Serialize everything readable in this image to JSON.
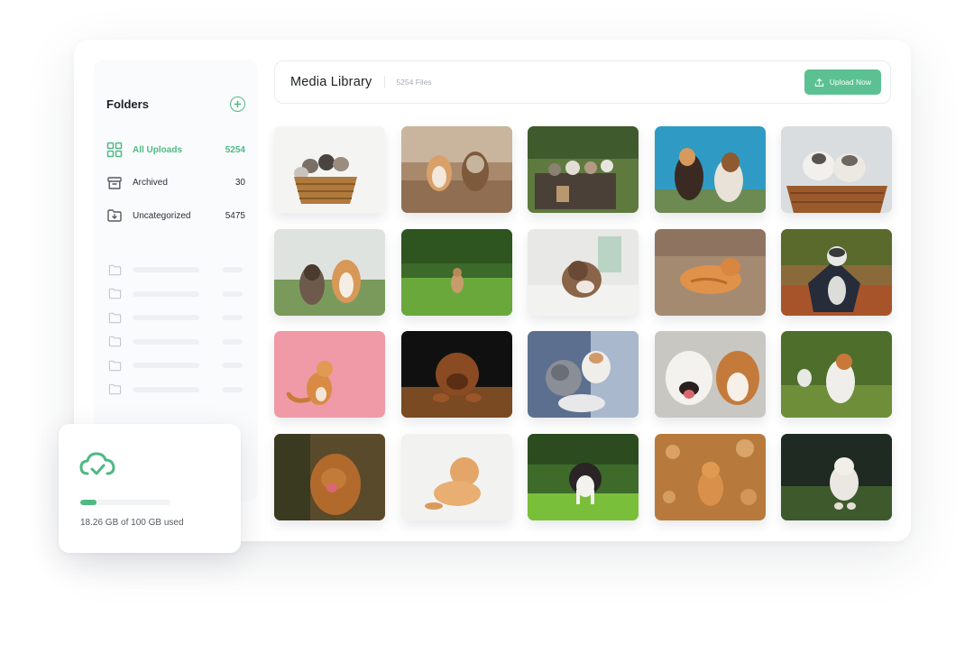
{
  "sidebar": {
    "title": "Folders",
    "add_icon": "plus-circle-icon",
    "folders": [
      {
        "label": "All Uploads",
        "count": "5254",
        "icon": "grid-icon",
        "active": true
      },
      {
        "label": "Archived",
        "count": "30",
        "icon": "archive-box-icon",
        "active": false
      },
      {
        "label": "Uncategorized",
        "count": "5475",
        "icon": "folder-download-icon",
        "active": false
      }
    ],
    "placeholder_folder_icon": "folder-outline-icon"
  },
  "header": {
    "title": "Media Library",
    "file_count": "5254 Files",
    "upload_label": "Upload Now",
    "upload_icon": "upload-icon"
  },
  "storage": {
    "icon": "cloud-check-icon",
    "usage_text": "18.26 GB of 100 GB used",
    "used_fraction": 0.1826
  },
  "colors": {
    "accent": "#4fb985",
    "button": "#5cc192"
  }
}
